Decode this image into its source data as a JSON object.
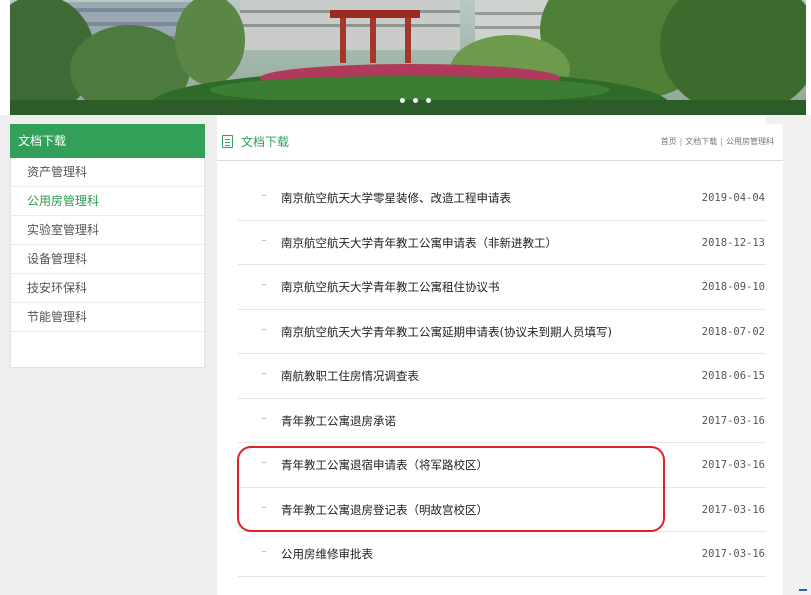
{
  "colors": {
    "accent_green": "#33a05a",
    "active_item": "#2a9d4c",
    "annotation_red": "#e0202a"
  },
  "banner": {
    "slide_dots": 3
  },
  "sidebar": {
    "header": "文档下载",
    "items": [
      {
        "label": "资产管理科",
        "active": false
      },
      {
        "label": "公用房管理科",
        "active": true
      },
      {
        "label": "实验室管理科",
        "active": false
      },
      {
        "label": "设备管理科",
        "active": false
      },
      {
        "label": "技安环保科",
        "active": false
      },
      {
        "label": "节能管理科",
        "active": false
      }
    ]
  },
  "content": {
    "title": "文档下载",
    "breadcrumb": [
      "首页",
      "文档下载",
      "公用房管理科"
    ],
    "documents": [
      {
        "title": "南京航空航天大学零星装修、改造工程申请表",
        "date": "2019-04-04"
      },
      {
        "title": "南京航空航天大学青年教工公寓申请表（非新进教工）",
        "date": "2018-12-13"
      },
      {
        "title": "南京航空航天大学青年教工公寓租住协议书",
        "date": "2018-09-10"
      },
      {
        "title": "南京航空航天大学青年教工公寓延期申请表(协议未到期人员填写)",
        "date": "2018-07-02"
      },
      {
        "title": "南航教职工住房情况调查表",
        "date": "2018-06-15"
      },
      {
        "title": "青年教工公寓退房承诺",
        "date": "2017-03-16"
      },
      {
        "title": "青年教工公寓退宿申请表（将军路校区）",
        "date": "2017-03-16"
      },
      {
        "title": "青年教工公寓退房登记表（明故宫校区）",
        "date": "2017-03-16"
      },
      {
        "title": "公用房维修审批表",
        "date": "2017-03-16"
      }
    ]
  }
}
